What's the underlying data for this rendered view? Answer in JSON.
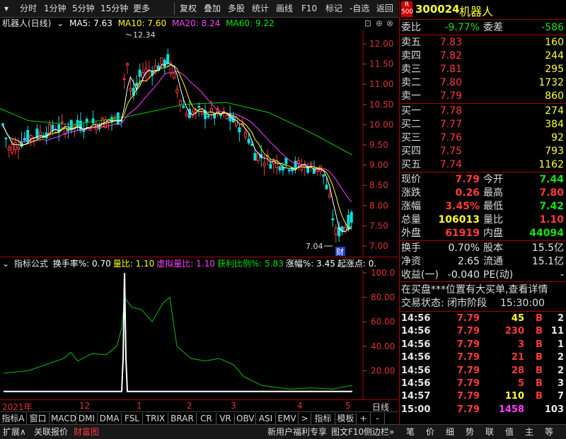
{
  "toolbar": {
    "items": [
      "分时",
      "1分钟",
      "5分钟",
      "15分钟",
      "更多",
      "复权",
      "叠加",
      "多股",
      "统计",
      "画线",
      "F10",
      "标记",
      "-自选",
      "返回"
    ]
  },
  "stock": {
    "code": "300024",
    "name": "机器人",
    "badge_top": "R",
    "badge_bottom": "500"
  },
  "main_chart": {
    "title": "机器人(日线)",
    "ma5": "MA5: 7.63",
    "ma10": "MA10: 7.60",
    "ma20": "MA20: 8.24",
    "ma60": "MA60: 9.22",
    "high_label": "12.34",
    "low_label": "7.04",
    "cai_badge": "财",
    "y_ticks": [
      "12.00",
      "11.50",
      "11.00",
      "10.50",
      "10.00",
      "9.50",
      "9.00",
      "8.50",
      "8.00",
      "7.50",
      "7.00"
    ],
    "colors": {
      "ma5": "#ffffff",
      "ma10": "#ffff00",
      "ma20": "#ff40ff",
      "ma60": "#00e000",
      "up": "#ff3b3b",
      "down": "#00e0e0"
    }
  },
  "indicator": {
    "title": "指标公式",
    "items": [
      {
        "label": "换手率%: 0.70",
        "color": "#ffffff"
      },
      {
        "label": "量比: 1.10",
        "color": "#ffff00"
      },
      {
        "label": "虚拟量比: 1.10",
        "color": "#ff40ff"
      },
      {
        "label": "获利比例%: 5.83",
        "color": "#00e000"
      },
      {
        "label": "涨幅%: 3.45",
        "color": "#ffffff"
      },
      {
        "label": "起涨点: 0.",
        "color": "#ffffff"
      }
    ],
    "y_ticks": [
      "100.0",
      "80.00",
      "60.00",
      "40.00",
      "20.00"
    ]
  },
  "date_axis": {
    "labels": [
      "2021年",
      "12",
      "1",
      "2",
      "3",
      "4",
      "5"
    ],
    "right_label": "日线"
  },
  "indicator_tabs": [
    "指标A",
    "窗口",
    "MACD",
    "DMI",
    "DMA",
    "FSL",
    "TRIX",
    "BRAR",
    "CR",
    "VR",
    "OBV",
    "ASI",
    "EMV",
    ">",
    "指标B",
    "模板",
    "+",
    "-"
  ],
  "bottom_bar": {
    "left": [
      "扩展∧",
      "关联报价",
      "财富图"
    ],
    "mid": "新用户福利专享",
    "right": [
      "图文F10",
      "侧边栏»"
    ],
    "icons": [
      "笔",
      "价",
      "细",
      "势",
      "联",
      "值",
      "主",
      "等"
    ]
  },
  "quote": {
    "weibi": {
      "label": "委比",
      "value": "-9.77%",
      "label2": "委差",
      "value2": "-586"
    },
    "asks": [
      {
        "label": "卖五",
        "price": "7.83",
        "vol": "160"
      },
      {
        "label": "卖四",
        "price": "7.82",
        "vol": "244"
      },
      {
        "label": "卖三",
        "price": "7.81",
        "vol": "295"
      },
      {
        "label": "卖二",
        "price": "7.80",
        "vol": "1732"
      },
      {
        "label": "卖一",
        "price": "7.79",
        "vol": "860"
      }
    ],
    "bids": [
      {
        "label": "买一",
        "price": "7.78",
        "vol": "274"
      },
      {
        "label": "买二",
        "price": "7.77",
        "vol": "384"
      },
      {
        "label": "买三",
        "price": "7.76",
        "vol": "92"
      },
      {
        "label": "买四",
        "price": "7.75",
        "vol": "793"
      },
      {
        "label": "买五",
        "price": "7.74",
        "vol": "1162"
      }
    ],
    "stats": [
      {
        "l1": "现价",
        "v1": "7.79",
        "c1": "red",
        "l2": "今开",
        "v2": "7.44",
        "c2": "green"
      },
      {
        "l1": "涨跌",
        "v1": "0.26",
        "c1": "red",
        "l2": "最高",
        "v2": "7.80",
        "c2": "red"
      },
      {
        "l1": "涨幅",
        "v1": "3.45%",
        "c1": "red",
        "l2": "最低",
        "v2": "7.42",
        "c2": "green"
      },
      {
        "l1": "总量",
        "v1": "106013",
        "c1": "yellow",
        "l2": "量比",
        "v2": "1.10",
        "c2": "red"
      },
      {
        "l1": "外盘",
        "v1": "61919",
        "c1": "red",
        "l2": "内盘",
        "v2": "44094",
        "c2": "green"
      }
    ],
    "stats2": [
      {
        "l1": "换手",
        "v1": "0.70%",
        "l2": "股本",
        "v2": "15.5亿"
      },
      {
        "l1": "净资",
        "v1": "2.65",
        "l2": "流通",
        "v2": "15.1亿"
      },
      {
        "l1": "收益(一)",
        "v1": "-0.040",
        "l2": "PE(动)",
        "v2": "-"
      }
    ],
    "notice": "在买盘***位置有大买单,查看详情",
    "status_label": "交易状态: 闭市阶段",
    "status_time": "15:30:00"
  },
  "ticks": [
    {
      "t": "14:56",
      "p": "7.79",
      "v": "45",
      "s": "B",
      "n": "2",
      "vc": "yellow"
    },
    {
      "t": "14:56",
      "p": "7.79",
      "v": "230",
      "s": "B",
      "n": "11",
      "vc": "red"
    },
    {
      "t": "14:56",
      "p": "7.79",
      "v": "3",
      "s": "B",
      "n": "1",
      "vc": "red"
    },
    {
      "t": "14:56",
      "p": "7.79",
      "v": "21",
      "s": "B",
      "n": "2",
      "vc": "red"
    },
    {
      "t": "14:56",
      "p": "7.79",
      "v": "28",
      "s": "B",
      "n": "2",
      "vc": "red"
    },
    {
      "t": "14:56",
      "p": "7.79",
      "v": "5",
      "s": "B",
      "n": "3",
      "vc": "red"
    },
    {
      "t": "14:57",
      "p": "7.79",
      "v": "110",
      "s": "B",
      "n": "7",
      "vc": "yellow"
    },
    {
      "t": "15:00",
      "p": "7.79",
      "v": "1458",
      "s": "",
      "n": "103",
      "vc": "mag"
    }
  ]
}
